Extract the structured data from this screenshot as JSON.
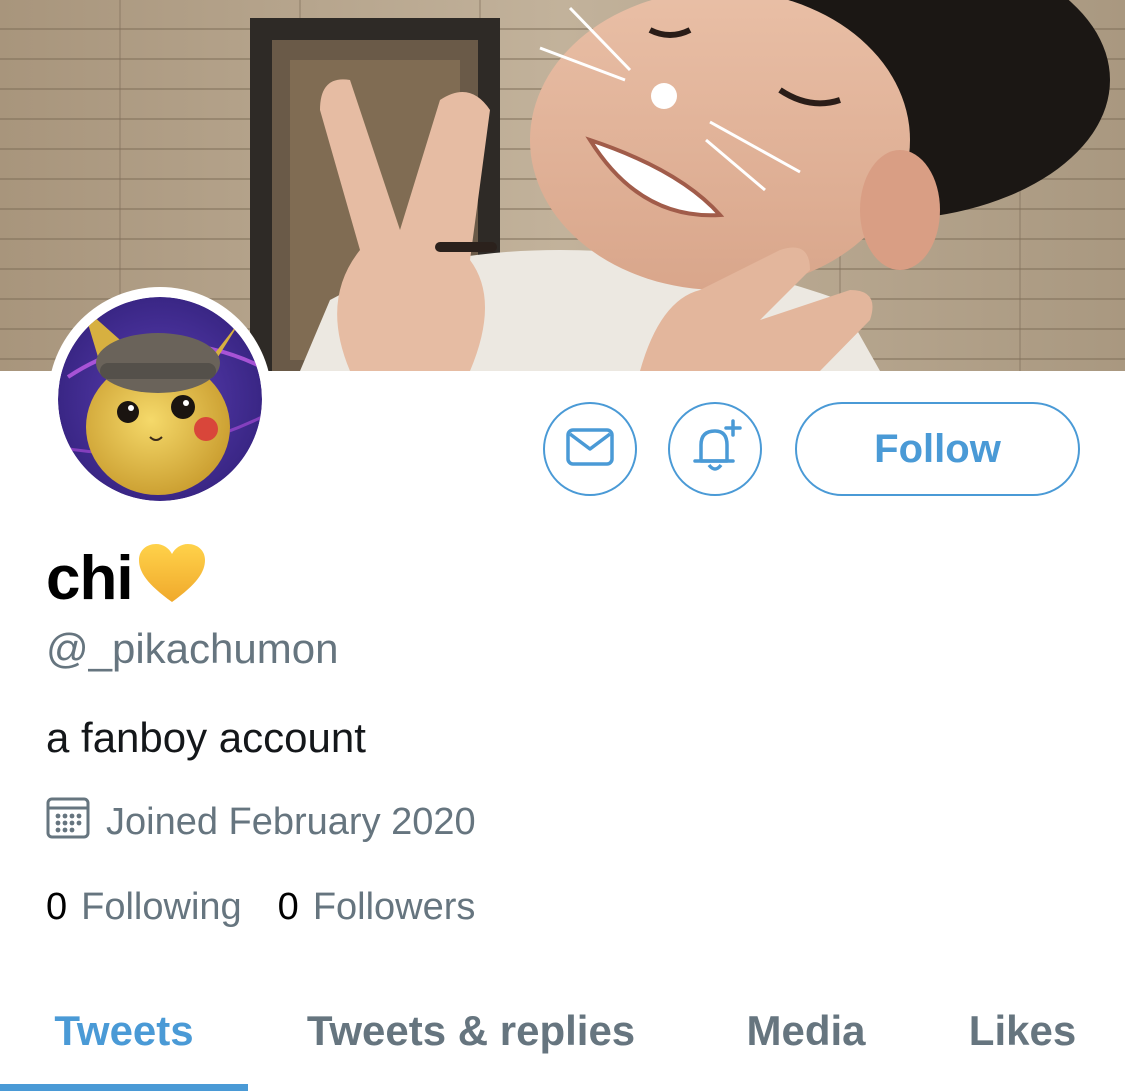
{
  "profile": {
    "display_name": "chi",
    "name_emoji": "yellow-heart-icon",
    "handle": "@_pikachumon",
    "bio": "a fanboy account",
    "joined": "Joined February 2020"
  },
  "actions": {
    "message_icon": "envelope-icon",
    "notify_icon": "bell-plus-icon",
    "follow_label": "Follow"
  },
  "stats": {
    "following_count": "0",
    "following_label": "Following",
    "followers_count": "0",
    "followers_label": "Followers"
  },
  "tabs": [
    {
      "label": "Tweets",
      "active": true
    },
    {
      "label": "Tweets & replies",
      "active": false
    },
    {
      "label": "Media",
      "active": false
    },
    {
      "label": "Likes",
      "active": false
    }
  ],
  "colors": {
    "accent": "#4a9ad6",
    "secondary_text": "#66757f",
    "heart": "#f5c542"
  }
}
